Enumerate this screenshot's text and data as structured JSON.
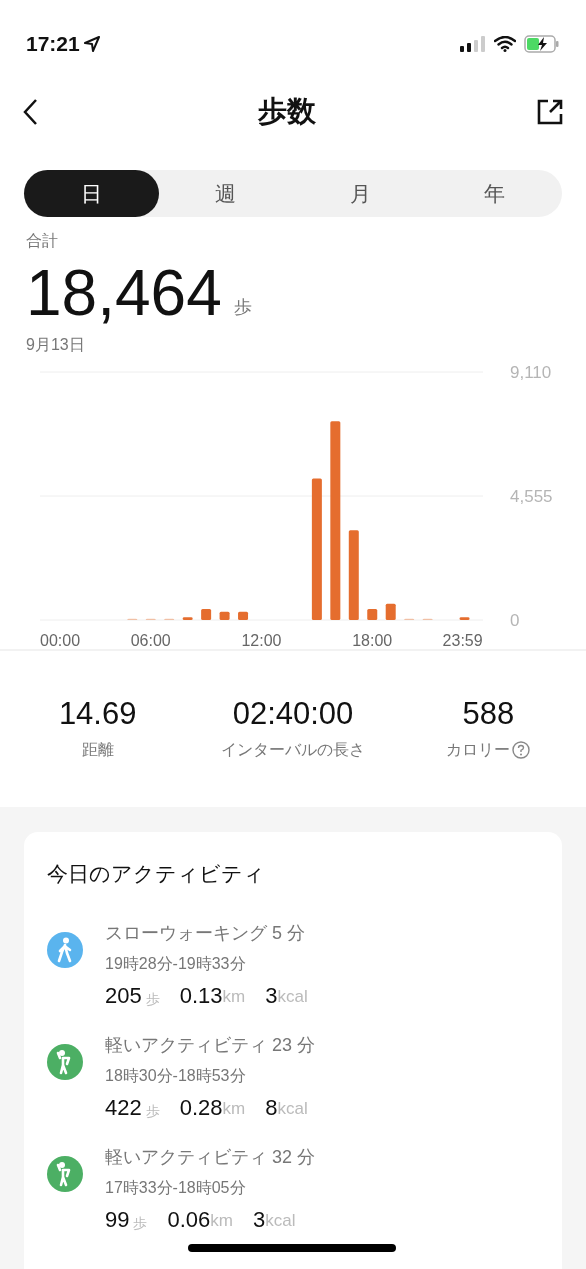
{
  "status_bar": {
    "time": "17:21"
  },
  "header": {
    "title": "歩数"
  },
  "tabs": [
    {
      "label": "日",
      "selected": true
    },
    {
      "label": "週",
      "selected": false
    },
    {
      "label": "月",
      "selected": false
    },
    {
      "label": "年",
      "selected": false
    }
  ],
  "summary": {
    "label": "合計",
    "value": "18,464",
    "unit": "歩",
    "date": "9月13日"
  },
  "chart_data": {
    "type": "bar",
    "x": [
      5,
      6,
      7,
      8,
      9,
      10,
      11,
      15,
      16,
      17,
      18,
      19,
      20,
      21,
      23
    ],
    "xlim": [
      0,
      24
    ],
    "series": [
      {
        "color": "#e56d2e",
        "values": [
          0,
          0,
          0,
          100,
          400,
          300,
          300,
          5200,
          7300,
          3300,
          400,
          600,
          0,
          0,
          100
        ]
      }
    ],
    "ylim": [
      0,
      9110
    ],
    "yticks": [
      {
        "value": 9110,
        "label": "9,110"
      },
      {
        "value": 4555,
        "label": "4,555"
      },
      {
        "value": 0,
        "label": "0"
      }
    ],
    "xticks": [
      {
        "value": 0,
        "label": "00:00"
      },
      {
        "value": 6,
        "label": "06:00"
      },
      {
        "value": 12,
        "label": "12:00"
      },
      {
        "value": 18,
        "label": "18:00"
      },
      {
        "value": 23.98,
        "label": "23:59"
      }
    ]
  },
  "stats": [
    {
      "value": "14.69",
      "label": "距離",
      "help": false
    },
    {
      "value": "02:40:00",
      "label": "インターバルの長さ",
      "help": false
    },
    {
      "value": "588",
      "label": "カロリー",
      "help": true
    }
  ],
  "activities": {
    "title": "今日のアクティビティ",
    "items": [
      {
        "kind": "walk",
        "color": "#5ab4ee",
        "name": "スローウォーキング",
        "duration": "5",
        "duration_unit": "分",
        "time_range": "19時28分-19時33分",
        "steps": "205",
        "steps_unit": "歩",
        "distance": "0.13",
        "distance_unit": "km",
        "calories": "3",
        "calories_unit": "kcal"
      },
      {
        "kind": "light",
        "color": "#4caf64",
        "name": "軽いアクティビティ",
        "duration": "23",
        "duration_unit": "分",
        "time_range": "18時30分-18時53分",
        "steps": "422",
        "steps_unit": "歩",
        "distance": "0.28",
        "distance_unit": "km",
        "calories": "8",
        "calories_unit": "kcal"
      },
      {
        "kind": "light",
        "color": "#4caf64",
        "name": "軽いアクティビティ",
        "duration": "32",
        "duration_unit": "分",
        "time_range": "17時33分-18時05分",
        "steps": "99",
        "steps_unit": "歩",
        "distance": "0.06",
        "distance_unit": "km",
        "calories": "3",
        "calories_unit": "kcal"
      }
    ]
  }
}
